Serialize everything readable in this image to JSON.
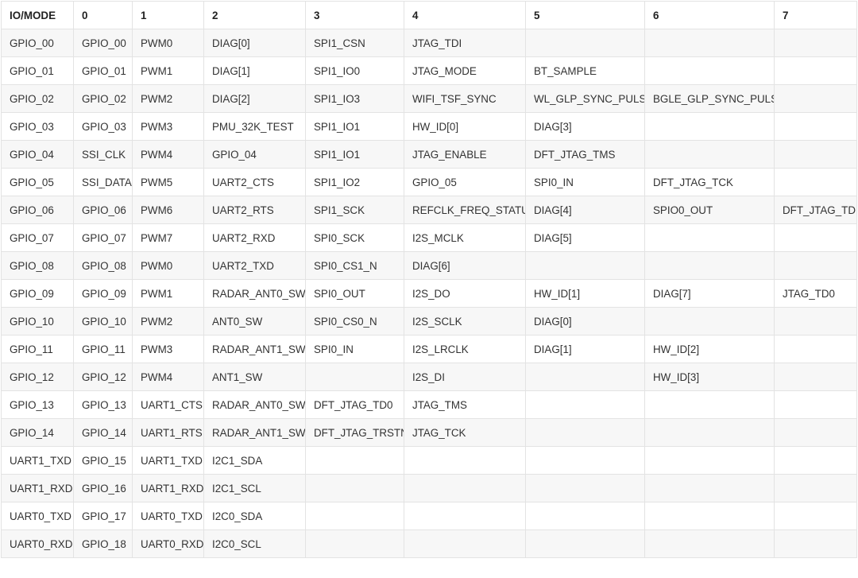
{
  "table": {
    "headers": [
      "IO/MODE",
      "0",
      "1",
      "2",
      "3",
      "4",
      "5",
      "6",
      "7"
    ],
    "rows": [
      [
        "GPIO_00",
        "GPIO_00",
        "PWM0",
        "DIAG[0]",
        "SPI1_CSN",
        "JTAG_TDI",
        "",
        "",
        ""
      ],
      [
        "GPIO_01",
        "GPIO_01",
        "PWM1",
        "DIAG[1]",
        "SPI1_IO0",
        "JTAG_MODE",
        "BT_SAMPLE",
        "",
        ""
      ],
      [
        "GPIO_02",
        "GPIO_02",
        "PWM2",
        "DIAG[2]",
        "SPI1_IO3",
        "WIFI_TSF_SYNC",
        "WL_GLP_SYNC_PULSE",
        "BGLE_GLP_SYNC_PULSE",
        ""
      ],
      [
        "GPIO_03",
        "GPIO_03",
        "PWM3",
        "PMU_32K_TEST",
        "SPI1_IO1",
        "HW_ID[0]",
        "DIAG[3]",
        "",
        ""
      ],
      [
        "GPIO_04",
        "SSI_CLK",
        "PWM4",
        "GPIO_04",
        "SPI1_IO1",
        "JTAG_ENABLE",
        "DFT_JTAG_TMS",
        "",
        ""
      ],
      [
        "GPIO_05",
        "SSI_DATA",
        "PWM5",
        "UART2_CTS",
        "SPI1_IO2",
        "GPIO_05",
        "SPI0_IN",
        "DFT_JTAG_TCK",
        ""
      ],
      [
        "GPIO_06",
        "GPIO_06",
        "PWM6",
        "UART2_RTS",
        "SPI1_SCK",
        "REFCLK_FREQ_STATUS",
        "DIAG[4]",
        "SPIO0_OUT",
        "DFT_JTAG_TDI"
      ],
      [
        "GPIO_07",
        "GPIO_07",
        "PWM7",
        "UART2_RXD",
        "SPI0_SCK",
        "I2S_MCLK",
        "DIAG[5]",
        "",
        ""
      ],
      [
        "GPIO_08",
        "GPIO_08",
        "PWM0",
        "UART2_TXD",
        "SPI0_CS1_N",
        "DIAG[6]",
        "",
        "",
        ""
      ],
      [
        "GPIO_09",
        "GPIO_09",
        "PWM1",
        "RADAR_ANT0_SW",
        "SPI0_OUT",
        "I2S_DO",
        "HW_ID[1]",
        "DIAG[7]",
        "JTAG_TD0"
      ],
      [
        "GPIO_10",
        "GPIO_10",
        "PWM2",
        "ANT0_SW",
        "SPI0_CS0_N",
        "I2S_SCLK",
        "DIAG[0]",
        "",
        ""
      ],
      [
        "GPIO_11",
        "GPIO_11",
        "PWM3",
        "RADAR_ANT1_SW",
        "SPI0_IN",
        "I2S_LRCLK",
        "DIAG[1]",
        "HW_ID[2]",
        ""
      ],
      [
        "GPIO_12",
        "GPIO_12",
        "PWM4",
        "ANT1_SW",
        "",
        "I2S_DI",
        "",
        "HW_ID[3]",
        ""
      ],
      [
        "GPIO_13",
        "GPIO_13",
        "UART1_CTS",
        "RADAR_ANT0_SW",
        "DFT_JTAG_TD0",
        "JTAG_TMS",
        "",
        "",
        ""
      ],
      [
        "GPIO_14",
        "GPIO_14",
        "UART1_RTS",
        "RADAR_ANT1_SW",
        "DFT_JTAG_TRSTN",
        "JTAG_TCK",
        "",
        "",
        ""
      ],
      [
        "UART1_TXD",
        "GPIO_15",
        "UART1_TXD",
        "I2C1_SDA",
        "",
        "",
        "",
        "",
        ""
      ],
      [
        "UART1_RXD",
        "GPIO_16",
        "UART1_RXD",
        "I2C1_SCL",
        "",
        "",
        "",
        "",
        ""
      ],
      [
        "UART0_TXD",
        "GPIO_17",
        "UART0_TXD",
        "I2C0_SDA",
        "",
        "",
        "",
        "",
        ""
      ],
      [
        "UART0_RXD",
        "GPIO_18",
        "UART0_RXD",
        "I2C0_SCL",
        "",
        "",
        "",
        "",
        ""
      ]
    ]
  }
}
